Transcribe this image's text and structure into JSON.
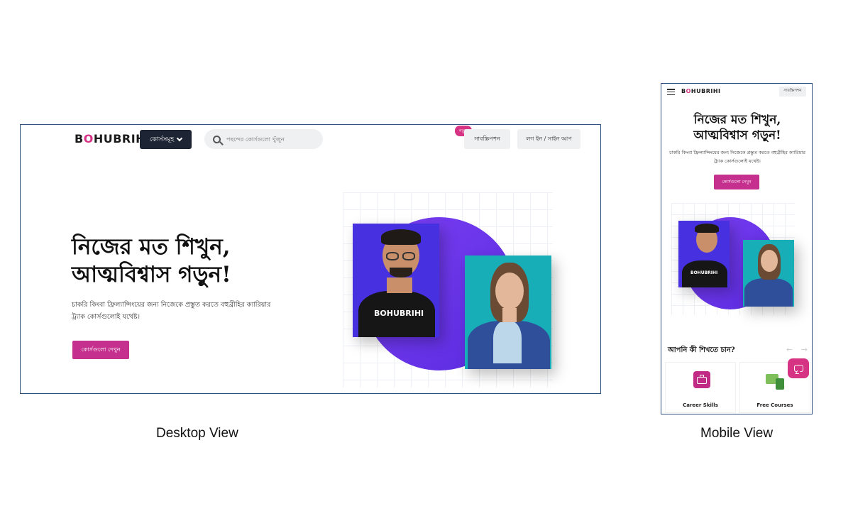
{
  "captions": {
    "desktop": "Desktop View",
    "mobile": "Mobile View"
  },
  "desktop": {
    "logo": {
      "pre": "B",
      "accent": "O",
      "post": "HUBRIHI"
    },
    "courses_menu_label": "কোর্সসমূহ",
    "search_placeholder": "পছন্দের কোর্সগুলো খুঁজুন",
    "new_badge": "নতুন",
    "subscription_label": "সাবস্ক্রিপশন",
    "login_label": "লগ ইন / সাইন আপ",
    "headline_line1": "নিজের মত শিখুন,",
    "headline_line2": "আত্মবিশ্বাস গড়ুন!",
    "subtext": "চাকরি কিংবা ফ্রিল্যান্সিংয়ের জন্য নিজেকে প্রস্তুত করতে বহুব্রীহির ক্যারিয়ার ট্র্যাক কোর্সগুলোই যথেষ্ট।",
    "cta_label": "কোর্সগুলো দেখুন",
    "shirt_text": "BOHUBRIHI"
  },
  "mobile": {
    "logo": {
      "pre": "B",
      "accent": "O",
      "post": "HUBRIHI"
    },
    "subscription_label": "সাবস্ক্রিপশন",
    "headline_line1": "নিজের মত শিখুন,",
    "headline_line2": "আত্মবিশ্বাস গড়ুন!",
    "subtext": "চাকরি কিংবা ফ্রিল্যান্সিংয়ের জন্য নিজেকে প্রস্তুত করতে বহুব্রীহির ক্যারিয়ার ট্র্যাক কোর্সগুলোই যথেষ্ট।",
    "cta_label": "কোর্সগুলো দেখুন",
    "question": "আপনি কী শিখতে চান?",
    "arrows": "← →",
    "shirt_text": "BOHUBRIHI",
    "categories": [
      {
        "label": "Career Skills",
        "icon": "briefcase-icon"
      },
      {
        "label": "Free Courses",
        "icon": "devices-icon"
      }
    ]
  },
  "colors": {
    "brand_pink": "#d63384",
    "cta_pink": "#c5308f",
    "nav_dark": "#1d2433",
    "hero_purple": "#6a35ea",
    "photo_blue": "#4630e0",
    "photo_teal": "#17aeb7"
  }
}
